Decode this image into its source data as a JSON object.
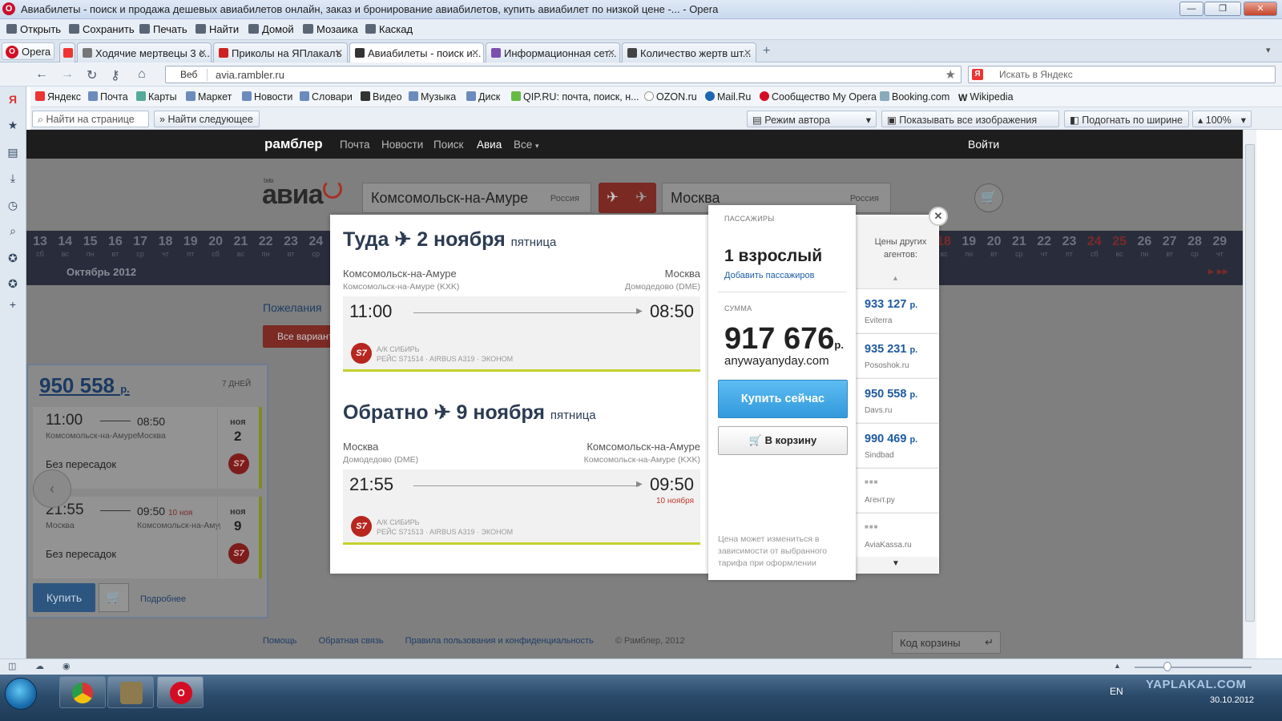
{
  "window": {
    "title": "Авиабилеты - поиск и продажа дешевых авиабилетов онлайн, заказ и бронирование авиабилетов, купить авиабилет по низкой цене -... - Opera"
  },
  "menu": [
    "Открыть",
    "Сохранить",
    "Печать",
    "Найти",
    "Домой",
    "Мозаика",
    "Каскад"
  ],
  "tabs": {
    "opera_label": "Opera",
    "items": [
      {
        "label": "Ходячие мертвецы 3 с..."
      },
      {
        "label": "Приколы на ЯПлакалъ"
      },
      {
        "label": "Авиабилеты - поиск и..."
      },
      {
        "label": "Информационная сет..."
      },
      {
        "label": "Количество жертв шт..."
      }
    ]
  },
  "address": {
    "proto": "Веб",
    "url": "avia.rambler.ru",
    "search_placeholder": "Искать в Яндекс"
  },
  "bookmarks": [
    "Яндекс",
    "Почта",
    "Карты",
    "Маркет",
    "Новости",
    "Словари",
    "Видео",
    "Музыка",
    "Диск",
    "QIP.RU: почта, поиск, н...",
    "OZON.ru",
    "Mail.Ru",
    "Сообщество My Opera",
    "Booking.com",
    "Wikipedia"
  ],
  "findbar": {
    "find_placeholder": "Найти на странице",
    "find_next": "Найти следующее",
    "author_mode": "Режим автора",
    "show_images": "Показывать все изображения",
    "fit_width": "Подогнать по ширине",
    "zoom": "100%"
  },
  "site": {
    "logo": "рамблер",
    "nav": [
      "Почта",
      "Новости",
      "Поиск",
      "Авиа",
      "Все"
    ],
    "login": "Войти",
    "avia_logo": "авиа",
    "beta": "beta",
    "from_city": "Комсомольск-на-Амуре",
    "from_country": "Россия",
    "to_city": "Москва",
    "to_country": "Россия",
    "dates": [
      {
        "n": "13",
        "d": "сб"
      },
      {
        "n": "14",
        "d": "вс"
      },
      {
        "n": "15",
        "d": "пн"
      },
      {
        "n": "16",
        "d": "вт"
      },
      {
        "n": "17",
        "d": "ср"
      },
      {
        "n": "18",
        "d": "чт"
      },
      {
        "n": "19",
        "d": "пт"
      },
      {
        "n": "20",
        "d": "сб"
      },
      {
        "n": "21",
        "d": "вс"
      },
      {
        "n": "22",
        "d": "пн"
      },
      {
        "n": "23",
        "d": "вт"
      },
      {
        "n": "24",
        "d": "ср"
      }
    ],
    "dates_right": [
      {
        "n": "18",
        "d": "вс"
      },
      {
        "n": "19",
        "d": "пн"
      },
      {
        "n": "20",
        "d": "вт"
      },
      {
        "n": "21",
        "d": "ср"
      },
      {
        "n": "22",
        "d": "чт"
      },
      {
        "n": "23",
        "d": "пт"
      },
      {
        "n": "24",
        "d": "сб"
      },
      {
        "n": "25",
        "d": "вс"
      },
      {
        "n": "26",
        "d": "пн"
      },
      {
        "n": "27",
        "d": "вт"
      },
      {
        "n": "28",
        "d": "ср"
      },
      {
        "n": "29",
        "d": "чт"
      }
    ],
    "month": "Октябрь 2012",
    "wishes": "Пожелания",
    "all_variants": "Все вариант",
    "footer": [
      "Помощь",
      "Обратная связь",
      "Правила пользования и конфиденциальность"
    ],
    "copyright": "© Рамблер, 2012",
    "basket_code": "Код корзины"
  },
  "card": {
    "price": "950 558",
    "currency": "р.",
    "days": "7 ДНЕЙ",
    "out": {
      "dep": "11:00",
      "arr": "08:50",
      "from": "Комсомольск-на-Амуре",
      "to": "Москва",
      "direct": "Без пересадок",
      "mon": "ноя",
      "day": "2"
    },
    "ret": {
      "dep": "21:55",
      "arr": "09:50",
      "arr_note": "10 ноя",
      "from": "Москва",
      "to": "Комсомольск-на-Амуре",
      "direct": "Без пересадок",
      "mon": "ноя",
      "day": "9"
    },
    "buy": "Купить",
    "more": "Подробнее"
  },
  "modal": {
    "out": {
      "title": "Туда ✈ 2 ноября",
      "weekday": "пятница",
      "from": "Комсомольск-на-Амуре",
      "from_airport": "Комсомольск-на-Амуре (KXK)",
      "to": "Москва",
      "to_airport": "Домодедово (DME)",
      "dep": "11:00",
      "arr": "08:50",
      "airline": "А/К СИБИРЬ",
      "flight": "РЕЙС S71514 · AIRBUS A319 · ЭКОНОМ"
    },
    "ret": {
      "title": "Обратно ✈ 9 ноября",
      "weekday": "пятница",
      "from": "Москва",
      "from_airport": "Домодедово (DME)",
      "to": "Комсомольск-на-Амуре",
      "to_airport": "Комсомольск-на-Амуре (KXK)",
      "dep": "21:55",
      "arr": "09:50",
      "arr_note": "10 ноября",
      "airline": "А/К СИБИРЬ",
      "flight": "РЕЙС S71513 · AIRBUS A319 · ЭКОНОМ"
    },
    "passengers_label": "ПАССАЖИРЫ",
    "passengers": "1 взрослый",
    "add_passengers": "Добавить пассажиров",
    "sum_label": "СУММА",
    "sum": "917 676",
    "sum_currency": "р.",
    "agency": "anywayanyday.com",
    "buy_now": "Купить сейчас",
    "to_cart": "В корзину",
    "note": "Цена может измениться в зависимости от выбранного тарифа при оформлении",
    "agents_title": "Цены других агентов:",
    "agents": [
      {
        "price": "933 127",
        "cur": "р.",
        "name": "Eviterra"
      },
      {
        "price": "935 231",
        "cur": "р.",
        "name": "Pososhok.ru"
      },
      {
        "price": "950 558",
        "cur": "р.",
        "name": "Davs.ru"
      },
      {
        "price": "990 469",
        "cur": "р.",
        "name": "Sindbad"
      },
      {
        "price": "",
        "cur": "",
        "name": "Агент.ру"
      },
      {
        "price": "",
        "cur": "",
        "name": "AviaKassa.ru"
      }
    ]
  },
  "taskbar": {
    "lang": "EN",
    "date": "30.10.2012",
    "watermark": "YAPLAKAL.COM"
  }
}
